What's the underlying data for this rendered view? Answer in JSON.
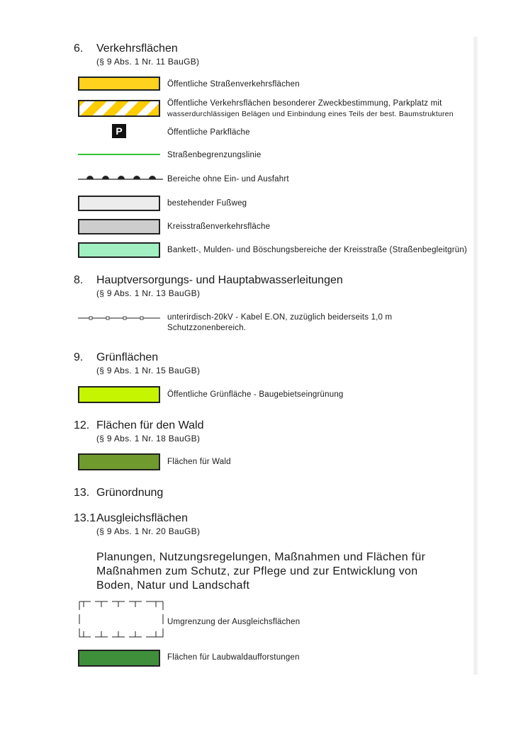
{
  "colors": {
    "strassenverkehr": "#ffd21e",
    "zweckbestimmung_stripe": "#ffcc00",
    "fussweg": "#ececec",
    "kreisstrasse": "#cdcdcd",
    "bankett": "#a2f0c2",
    "gruenflaeche": "#c5f500",
    "wald": "#6f9a2e",
    "laubwald": "#3f8f3a",
    "begrenzungslinie": "#33c233"
  },
  "sections": {
    "s6": {
      "number": "6.",
      "title": "Verkehrsflächen",
      "ref": "(§ 9 Abs. 1 Nr. 11 BauGB)",
      "items": [
        {
          "icon": "yellow-fill-swatch",
          "label": "Öffentliche Straßenverkehrsflächen"
        },
        {
          "icon": "yellow-striped-swatch",
          "label": "Öffentliche Verkehrsflächen besonderer Zweckbestimmung, Parkplatz mit",
          "label2": "wasserdurchlässigen Belägen und Einbindung eines Teils der best. Baumstrukturen"
        },
        {
          "icon": "parking-icon",
          "glyph": "P",
          "label": "Öffentliche Parkfläche"
        },
        {
          "icon": "green-line-icon",
          "label": "Straßenbegrenzungslinie"
        },
        {
          "icon": "no-access-line-icon",
          "label": "Bereiche ohne Ein- und Ausfahrt"
        },
        {
          "icon": "light-gray-swatch",
          "label": "bestehender Fußweg"
        },
        {
          "icon": "gray-swatch",
          "label": "Kreisstraßenverkehrsfläche"
        },
        {
          "icon": "mint-swatch",
          "label": "Bankett-, Mulden- und Böschungsbereiche der Kreisstraße (Straßenbegleitgrün)"
        }
      ]
    },
    "s8": {
      "number": "8.",
      "title": "Hauptversorgungs- und Hauptabwasserleitungen",
      "ref": "(§ 9 Abs. 1 Nr. 13 BauGB)",
      "items": [
        {
          "icon": "underground-cable-line-icon",
          "label": "unterirdisch-20kV - Kabel E.ON, zuzüglich beiderseits 1,0 m",
          "label2": "Schutzzonenbereich."
        }
      ]
    },
    "s9": {
      "number": "9.",
      "title": "Grünflächen",
      "ref": "(§ 9 Abs. 1 Nr. 15 BauGB)",
      "items": [
        {
          "icon": "lime-swatch",
          "label": "Öffentliche Grünfläche - Baugebietseingrünung"
        }
      ]
    },
    "s12": {
      "number": "12.",
      "title": "Flächen für den Wald",
      "ref": "(§ 9 Abs. 1 Nr. 18 BauGB)",
      "items": [
        {
          "icon": "olive-swatch",
          "label": "Flächen für Wald"
        }
      ]
    },
    "s13": {
      "number": "13.",
      "title": "Grünordnung"
    },
    "s13_1": {
      "number": "13.1",
      "title": "Ausgleichsflächen",
      "ref": "(§ 9 Abs. 1 Nr. 20 BauGB)",
      "paragraph": [
        "Planungen, Nutzungsregelungen, Maßnahmen und Flächen für",
        "Maßnahmen zum Schutz, zur Pflege und zur Entwicklung von",
        "Boden, Natur und Landschaft"
      ],
      "items": [
        {
          "icon": "boundary-outline-icon",
          "label": "Umgrenzung der Ausgleichsflächen"
        },
        {
          "icon": "dark-green-swatch",
          "label": "Flächen für Laubwaldaufforstungen"
        }
      ]
    }
  }
}
